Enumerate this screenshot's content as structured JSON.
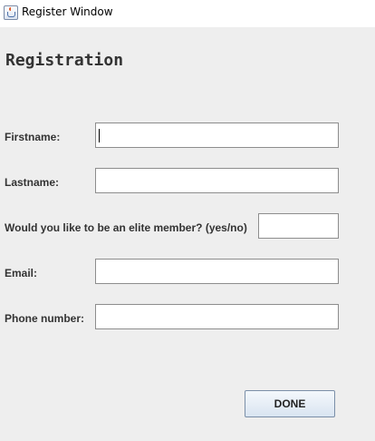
{
  "window": {
    "title": "Register Window",
    "icon": "java-cup-icon"
  },
  "form": {
    "heading": "Registration",
    "fields": [
      {
        "label": "Firstname:",
        "value": "",
        "placeholder": ""
      },
      {
        "label": "Lastname:",
        "value": "",
        "placeholder": ""
      },
      {
        "label": "Would you like to be an elite member? (yes/no)",
        "value": "",
        "placeholder": ""
      },
      {
        "label": "Email:",
        "value": "",
        "placeholder": ""
      },
      {
        "label": "Phone number:",
        "value": "",
        "placeholder": ""
      }
    ],
    "done_label": "DONE"
  }
}
